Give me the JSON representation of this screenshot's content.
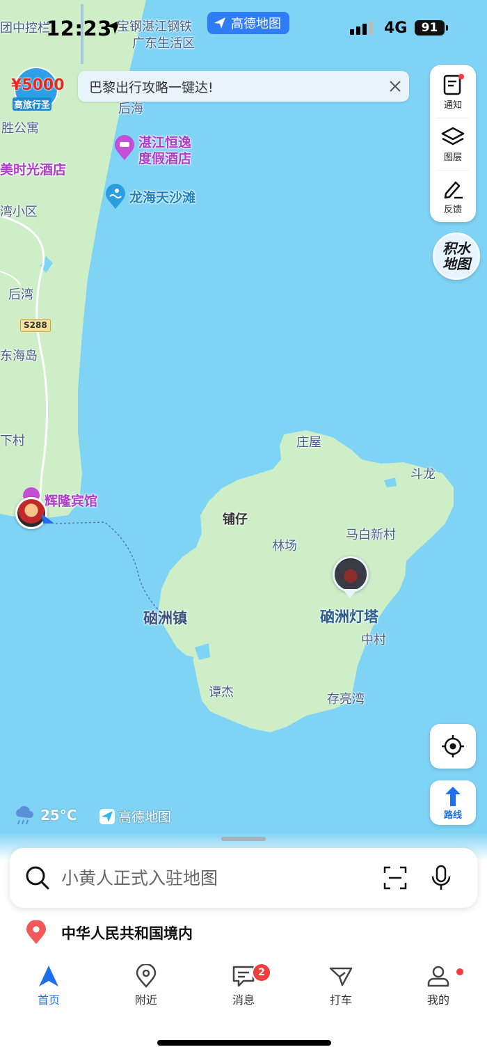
{
  "status_bar": {
    "time": "12:23",
    "brand": "高德地图",
    "network": "4G",
    "battery": "91"
  },
  "banner": {
    "text": "巴黎出行攻略一键达!"
  },
  "promo": {
    "amount": "¥5000",
    "subtitle": "高旅行圣"
  },
  "right_tools": [
    {
      "label": "通知",
      "icon": "notification-icon",
      "has_dot": true
    },
    {
      "label": "图层",
      "icon": "layers-icon"
    },
    {
      "label": "反馈",
      "icon": "feedback-icon"
    }
  ],
  "jishui": {
    "text": "积水地图"
  },
  "route_button": {
    "label": "路线"
  },
  "weather": {
    "temp": "25°C",
    "icon": "cloud-rain-icon"
  },
  "map_brand": {
    "text": "高德地图"
  },
  "map_labels": {
    "top1": "团中控栏",
    "top2": "宝钢湛江钢铁",
    "top3": "广东生活区",
    "houhai": "后海",
    "shenggongyu": "胜公寓",
    "shiguang": "美时光酒店",
    "hengyi": "湛江恒逸",
    "hengyi2": "度假酒店",
    "longhai": "龙海天沙滩",
    "xiaoqu": "湾小区",
    "houwan": "后湾",
    "road": "S288",
    "donghaidao": "东海岛",
    "xiacun": "下村",
    "huilong": "辉隆宾馆",
    "zhuangwu": "庄屋",
    "doulong": "斗龙",
    "puzai": "铺仔",
    "linchang": "林场",
    "mabaixin": "马白新村",
    "naozhouzhen": "硇洲镇",
    "dengta": "硇洲灯塔",
    "zhongcun": "中村",
    "tanjie": "谭杰",
    "cunliangwan": "存亮湾"
  },
  "search": {
    "placeholder": "小黄人正式入驻地图"
  },
  "location": {
    "text": "中华人民共和国境内"
  },
  "tabs": [
    {
      "label": "首页",
      "icon": "home-navigation-icon",
      "active": true
    },
    {
      "label": "附近",
      "icon": "nearby-pin-icon"
    },
    {
      "label": "消息",
      "icon": "message-icon",
      "badge": "2"
    },
    {
      "label": "打车",
      "icon": "taxi-icon"
    },
    {
      "label": "我的",
      "icon": "profile-icon",
      "has_dot": true
    }
  ],
  "colors": {
    "sea": "#7fd3f5",
    "land": "#cdeec7",
    "accent": "#1e6ff0",
    "badge": "#f03d3d"
  }
}
